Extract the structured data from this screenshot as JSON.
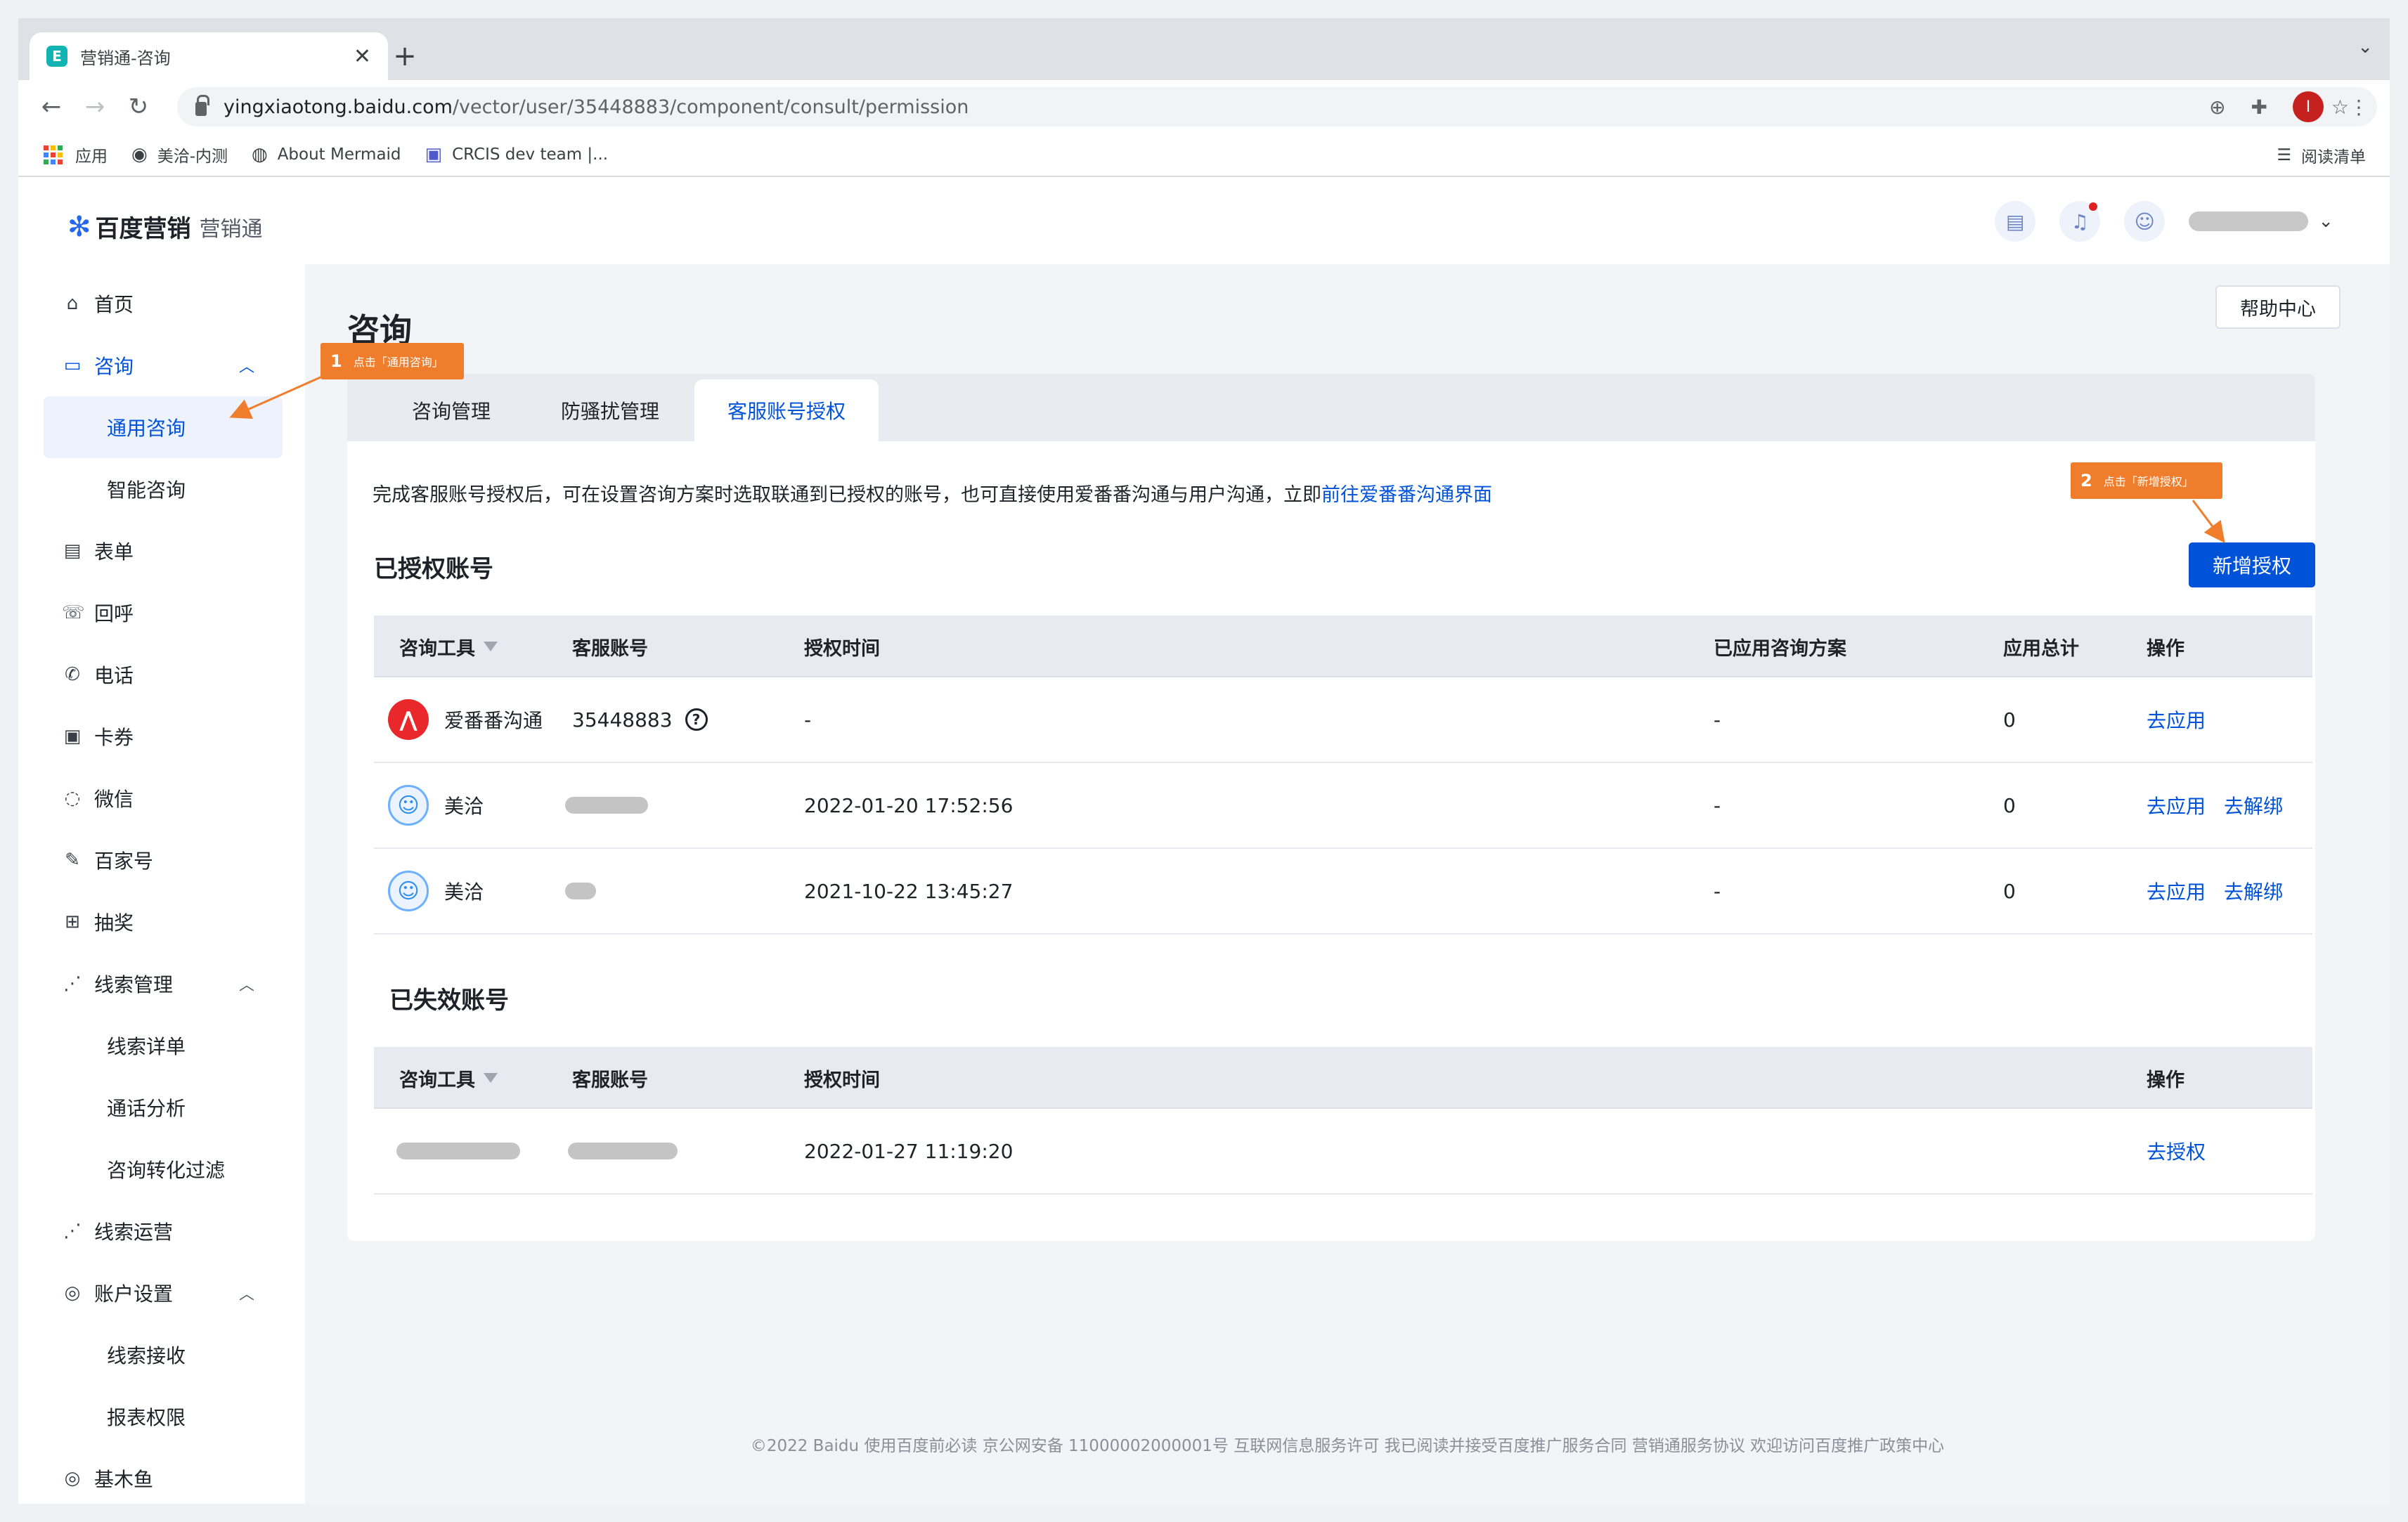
{
  "browser": {
    "tab_title": "营销通-咨询",
    "tab_favicon": "E",
    "url_host": "yingxiaotong.baidu.com",
    "url_path": "/vector/user/35448883/component/consult/permission",
    "profile_initial": "I",
    "bookmarks": [
      {
        "label": "应用",
        "icon": "apps-grid-icon"
      },
      {
        "label": "美洽-内测",
        "icon": "github-icon"
      },
      {
        "label": "About Mermaid",
        "icon": "globe-icon"
      },
      {
        "label": "CRCIS dev team |...",
        "icon": "teams-icon"
      }
    ],
    "reading_list": "阅读清单"
  },
  "brand": {
    "name": "百度营销",
    "product": "营销通"
  },
  "sidebar": {
    "items": [
      {
        "label": "首页",
        "icon": "home-icon"
      },
      {
        "label": "咨询",
        "icon": "chat-icon"
      },
      {
        "label": "通用咨询"
      },
      {
        "label": "智能咨询"
      },
      {
        "label": "表单",
        "icon": "form-icon"
      },
      {
        "label": "回呼",
        "icon": "callback-icon"
      },
      {
        "label": "电话",
        "icon": "phone-icon"
      },
      {
        "label": "卡券",
        "icon": "coupon-icon"
      },
      {
        "label": "微信",
        "icon": "wechat-icon"
      },
      {
        "label": "百家号",
        "icon": "edit-icon"
      },
      {
        "label": "抽奖",
        "icon": "gift-icon"
      },
      {
        "label": "线索管理",
        "icon": "chart-icon"
      },
      {
        "label": "线索详单"
      },
      {
        "label": "通话分析"
      },
      {
        "label": "咨询转化过滤"
      },
      {
        "label": "线索运营",
        "icon": "chart-icon"
      },
      {
        "label": "账户设置",
        "icon": "settings-icon"
      },
      {
        "label": "线索接收"
      },
      {
        "label": "报表权限"
      },
      {
        "label": "基木鱼",
        "icon": "fish-icon"
      }
    ]
  },
  "page": {
    "title": "咨询",
    "help_label": "帮助中心",
    "tabs": [
      "咨询管理",
      "防骚扰管理",
      "客服账号授权"
    ],
    "notice_text": "完成客服账号授权后，可在设置咨询方案时选取联通到已授权的账号，也可直接使用爱番番沟通与用户沟通，立即",
    "notice_link": "前往爱番番沟通界面",
    "authorized_title": "已授权账号",
    "add_button": "新增授权",
    "authorized_columns": [
      "咨询工具",
      "客服账号",
      "授权时间",
      "已应用咨询方案",
      "应用总计",
      "操作"
    ],
    "authorized_rows": [
      {
        "tool": "爱番番沟通",
        "account": "35448883",
        "time": "-",
        "scheme": "-",
        "total": "0",
        "actions": [
          "去应用"
        ]
      },
      {
        "tool": "美洽",
        "account": "",
        "time": "2022-01-20 17:52:56",
        "scheme": "-",
        "total": "0",
        "actions": [
          "去应用",
          "去解绑"
        ]
      },
      {
        "tool": "美洽",
        "account": "",
        "time": "2021-10-22 13:45:27",
        "scheme": "-",
        "total": "0",
        "actions": [
          "去应用",
          "去解绑"
        ]
      }
    ],
    "expired_title": "已失效账号",
    "expired_columns": [
      "咨询工具",
      "客服账号",
      "授权时间",
      "操作"
    ],
    "expired_rows": [
      {
        "time": "2022-01-27 11:19:20",
        "action": "去授权"
      }
    ]
  },
  "annotations": [
    {
      "num": "1",
      "text": "点击「通用咨询」"
    },
    {
      "num": "2",
      "text": "点击「新增授权」"
    }
  ],
  "footer": "©2022  Baidu 使用百度前必读 京公网安备 11000002000001号 互联网信息服务许可 我已阅读并接受百度推广服务合同 营销通服务协议 欢迎访问百度推广政策中心",
  "colors": {
    "accent": "#0052d9",
    "annotation": "#ef7d2b"
  }
}
